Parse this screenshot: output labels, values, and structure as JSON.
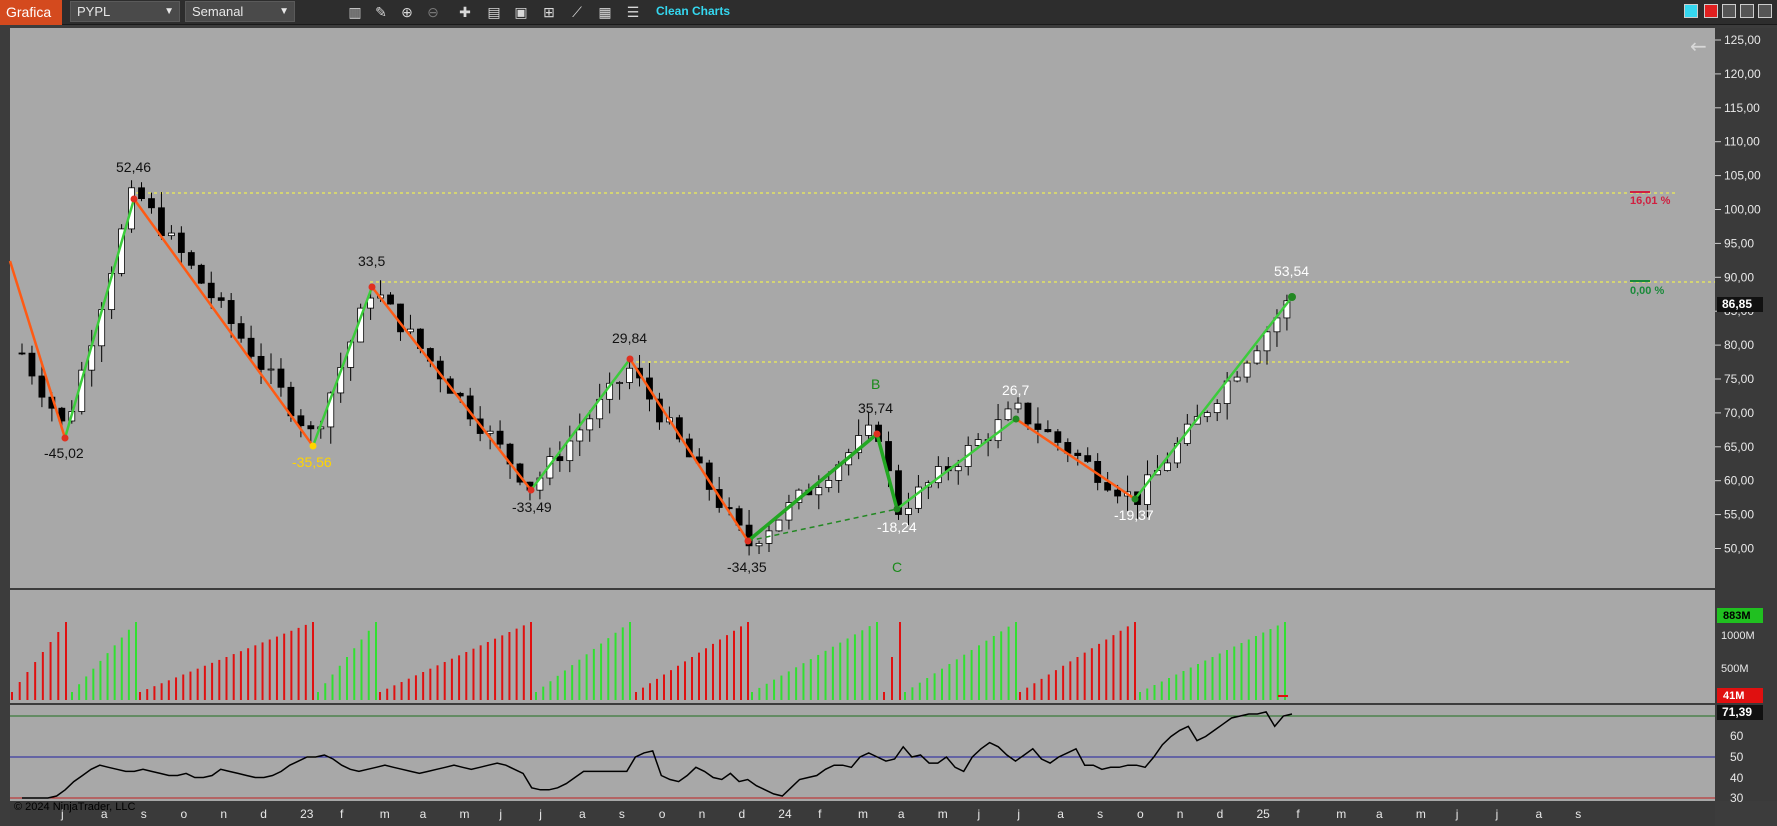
{
  "toolbar": {
    "title": "Grafica",
    "instrument": "PYPL",
    "interval": "Semanal",
    "clean_charts_label": "Clean Charts",
    "accent": "#d44a1e",
    "icons": [
      "bars-icon",
      "pencil-icon",
      "zoom-in-icon",
      "zoom-out-icon",
      "crosshair-icon",
      "properties-icon",
      "data-box-icon",
      "templates-icon",
      "strategies-icon",
      "indicators-icon",
      "list-icon"
    ]
  },
  "copyright": "© 2024 NinjaTrader, LLC",
  "price_axis": {
    "labels": [
      "125,00",
      "120,00",
      "115,00",
      "110,00",
      "105,00",
      "100,00",
      "95,00",
      "90,00",
      "85,00",
      "80,00",
      "75,00",
      "70,00",
      "65,00",
      "60,00",
      "55,00",
      "50,00"
    ],
    "last_price": "86,85"
  },
  "volume_axis": {
    "labels": [
      "1000M",
      "500M"
    ],
    "badge_up": "883M",
    "badge_down": "41M"
  },
  "rsi_axis": {
    "labels": [
      "60",
      "50",
      "40",
      "30"
    ],
    "badge": "71,39"
  },
  "time_axis": [
    "j",
    "a",
    "s",
    "o",
    "n",
    "d",
    "23",
    "f",
    "m",
    "a",
    "m",
    "j",
    "j",
    "a",
    "s",
    "o",
    "n",
    "d",
    "24",
    "f",
    "m",
    "a",
    "m",
    "j",
    "j",
    "a",
    "s",
    "o",
    "n",
    "d",
    "25",
    "f",
    "m",
    "a",
    "m",
    "j",
    "j",
    "a",
    "s"
  ],
  "swing_labels": {
    "s1": "52,46",
    "s2": "-45,02",
    "s3": "33,5",
    "s4": "-35,56",
    "s5": "29,84",
    "s6": "-33,49",
    "s7": "35,74",
    "s8": "-34,35",
    "s9": "26,7",
    "s10": "-18,24",
    "s11": "-19,37",
    "s12": "53,54",
    "wave_b": "B",
    "wave_c": "C"
  },
  "fib_labels": {
    "upper": "16,01 %",
    "lower": "0,00 %"
  },
  "chart_data": {
    "type": "candlestick",
    "symbol": "PYPL",
    "interval": "Semanal",
    "ylim": [
      47,
      127
    ],
    "swing_points": [
      {
        "label": "-45,02",
        "price": 67.5
      },
      {
        "label": "52,46",
        "price": 103.0
      },
      {
        "label": "-35,56",
        "price": 66.5
      },
      {
        "label": "33,5",
        "price": 88.5
      },
      {
        "label": "-33,49",
        "price": 59.0
      },
      {
        "label": "29,84",
        "price": 76.5
      },
      {
        "label": "-34,35",
        "price": 50.5
      },
      {
        "label": "35,74",
        "price": 68.0
      },
      {
        "label": "-18,24",
        "price": 55.5
      },
      {
        "label": "26,7",
        "price": 70.5
      },
      {
        "label": "-19,37",
        "price": 57.0
      },
      {
        "label": "53,54",
        "price": 87.0
      }
    ],
    "horizontal_levels": [
      103.3,
      89.0,
      76.5
    ],
    "last_price": 86.85,
    "volume_last": "883M",
    "rsi_last": 71.39,
    "rsi_levels": [
      50,
      30
    ]
  }
}
